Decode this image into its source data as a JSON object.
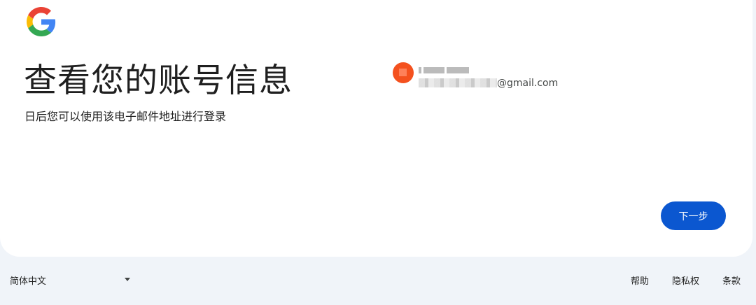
{
  "logo": {
    "icon": "google-g-icon"
  },
  "main": {
    "title": "查看您的账号信息",
    "subtitle": "日后您可以使用该电子邮件地址进行登录"
  },
  "account": {
    "avatar_color": "#f4511e",
    "email_visible_part": "@gmail.com"
  },
  "actions": {
    "next_label": "下一步",
    "next_color": "#0b57d0"
  },
  "footer": {
    "language": "简体中文",
    "links": [
      "帮助",
      "隐私权",
      "条款"
    ]
  }
}
